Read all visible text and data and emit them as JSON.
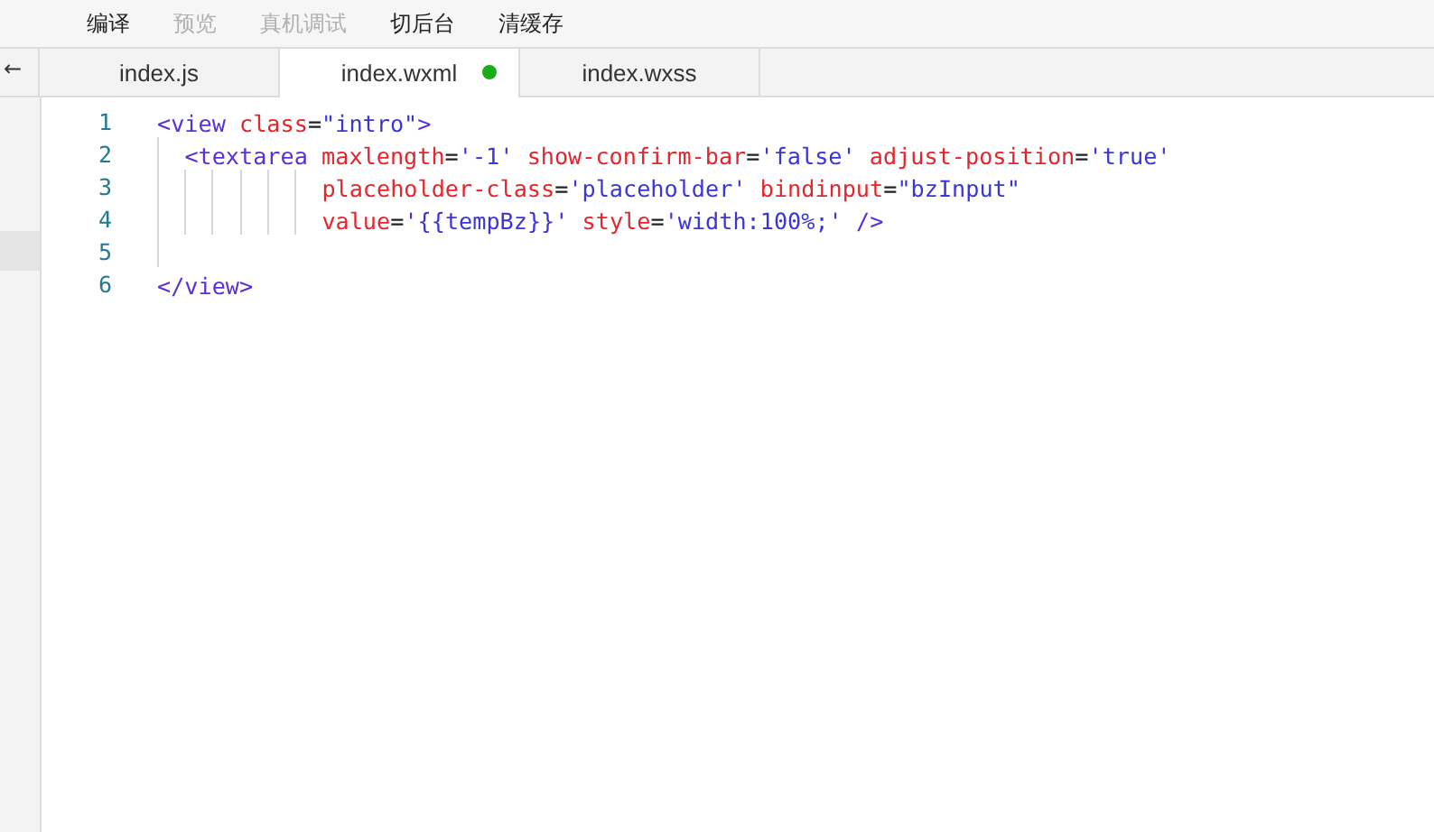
{
  "toolbar": [
    {
      "label": "编译",
      "disabled": false
    },
    {
      "label": "预览",
      "disabled": true
    },
    {
      "label": "真机调试",
      "disabled": true
    },
    {
      "label": "切后台",
      "disabled": false
    },
    {
      "label": "清缓存",
      "disabled": false
    }
  ],
  "back_arrow": "←",
  "tabs": [
    {
      "label": "index.js",
      "selected": false,
      "modified": false
    },
    {
      "label": "index.wxml",
      "selected": true,
      "modified": true
    },
    {
      "label": "index.wxss",
      "selected": false,
      "modified": false
    }
  ],
  "lines": [
    {
      "number": "1",
      "current": false,
      "kind": "top",
      "tokens": [
        {
          "kind": "tag",
          "text": "<view"
        },
        {
          "kind": "attr",
          "text": "class",
          "space_before": true
        },
        {
          "kind": "punct",
          "text": "="
        },
        {
          "kind": "string",
          "text": "\"intro\""
        },
        {
          "kind": "tag",
          "text": ">"
        }
      ]
    },
    {
      "number": "2",
      "current": false,
      "kind": "child",
      "tokens": [
        {
          "kind": "tag",
          "text": "<textarea"
        },
        {
          "kind": "attr",
          "text": "maxlength",
          "space_before": true
        },
        {
          "kind": "punct",
          "text": "="
        },
        {
          "kind": "string",
          "text": "'-1'"
        },
        {
          "kind": "attr",
          "text": "show-confirm-bar",
          "space_before": true
        },
        {
          "kind": "punct",
          "text": "="
        },
        {
          "kind": "string",
          "text": "'false'"
        },
        {
          "kind": "attr",
          "text": "adjust-position",
          "space_before": true
        },
        {
          "kind": "punct",
          "text": "="
        },
        {
          "kind": "string",
          "text": "'true'"
        }
      ]
    },
    {
      "number": "3",
      "current": false,
      "kind": "continuation",
      "tokens": [
        {
          "kind": "attr",
          "text": "placeholder-class"
        },
        {
          "kind": "punct",
          "text": "="
        },
        {
          "kind": "string",
          "text": "'placeholder'"
        },
        {
          "kind": "attr",
          "text": "bindinput",
          "space_before": true
        },
        {
          "kind": "punct",
          "text": "="
        },
        {
          "kind": "string",
          "text": "\"bzInput\""
        }
      ]
    },
    {
      "number": "4",
      "current": false,
      "kind": "continuation",
      "tokens": [
        {
          "kind": "attr",
          "text": "value"
        },
        {
          "kind": "punct",
          "text": "="
        },
        {
          "kind": "string",
          "text": "'{{tempBz}}'"
        },
        {
          "kind": "attr",
          "text": "style",
          "space_before": true
        },
        {
          "kind": "punct",
          "text": "="
        },
        {
          "kind": "string",
          "text": "'width:100%;'"
        },
        {
          "kind": "tag",
          "text": "/>",
          "space_before": true
        }
      ]
    },
    {
      "number": "5",
      "current": true,
      "kind": "blank"
    },
    {
      "number": "6",
      "current": false,
      "kind": "top",
      "tokens": [
        {
          "kind": "tag",
          "text": "</view>"
        }
      ]
    }
  ]
}
